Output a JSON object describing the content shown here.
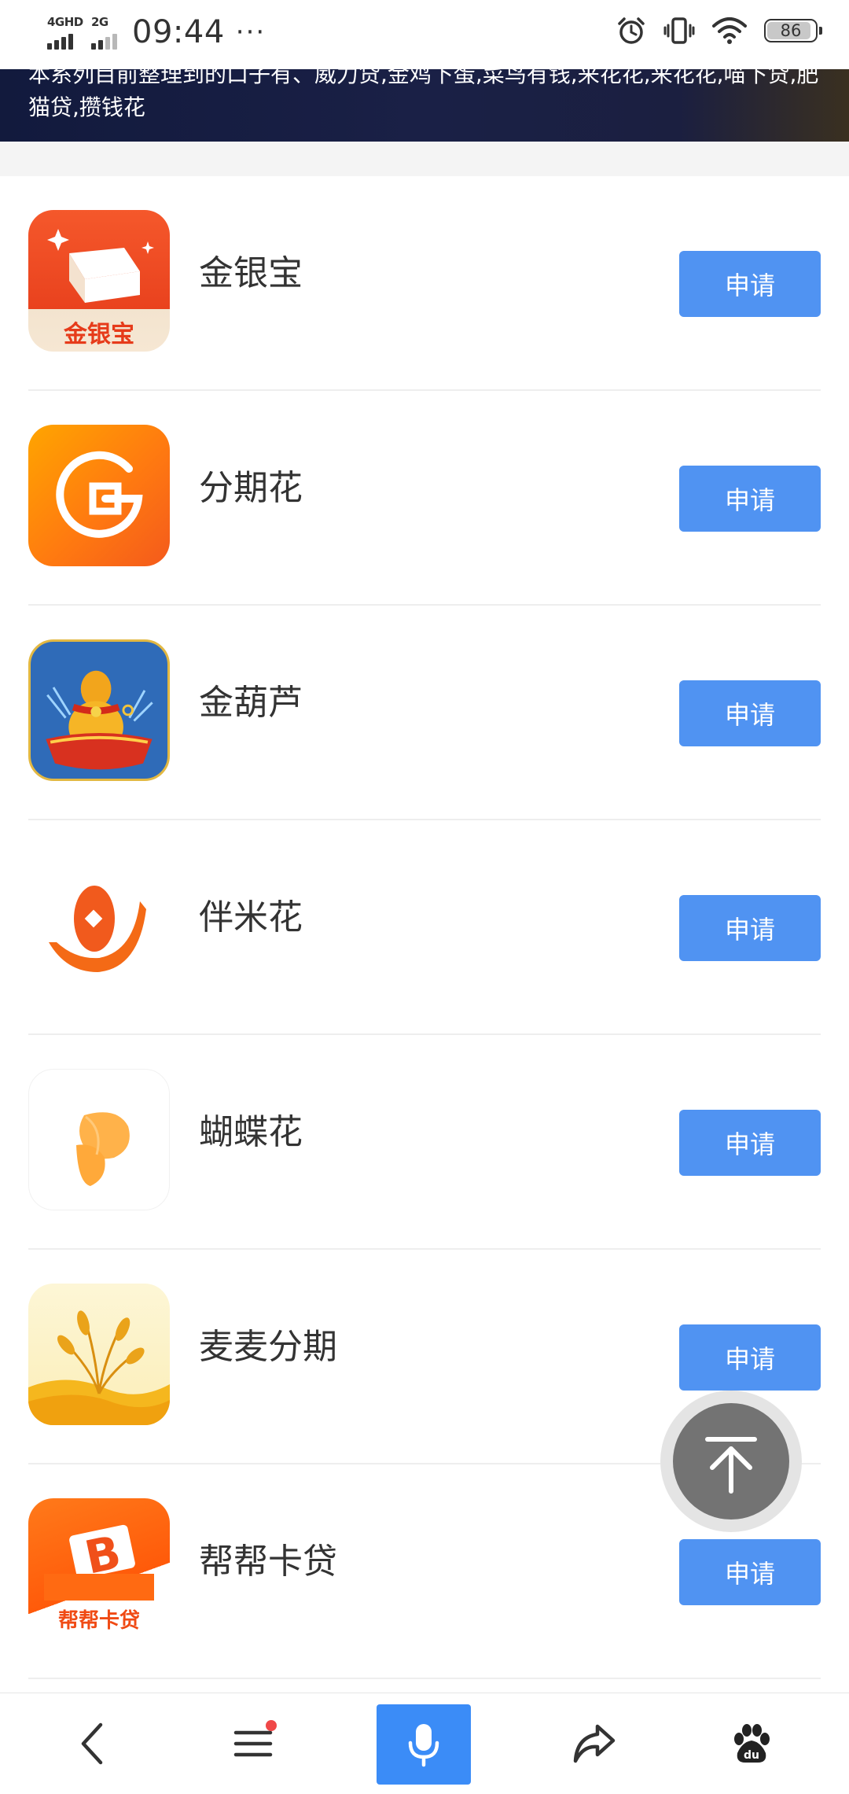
{
  "status_bar": {
    "network_1": "4GHD",
    "network_2": "2G",
    "time": "09:44",
    "more": "···",
    "battery": "86"
  },
  "banner": {
    "text": "本系列目前整理到的口子有、威力贷,金鸡下蛋,菜鸟有钱,来花花,来花花,喵下贷,肥猫贷,攒钱花"
  },
  "apply_label": "申请",
  "apps": [
    {
      "name": "金银宝",
      "icon": "gold-ingot-icon",
      "icon_text": "金银宝"
    },
    {
      "name": "分期花",
      "icon": "g-ring-icon"
    },
    {
      "name": "金葫芦",
      "icon": "gourd-icon"
    },
    {
      "name": "伴米花",
      "icon": "rice-hand-icon"
    },
    {
      "name": "蝴蝶花",
      "icon": "butterfly-icon"
    },
    {
      "name": "麦麦分期",
      "icon": "wheat-icon"
    },
    {
      "name": "帮帮卡贷",
      "icon": "b-card-icon",
      "icon_text": "帮帮卡贷"
    }
  ],
  "colors": {
    "apply_button": "#5093f2",
    "mic_button": "#3b8cf7",
    "banner_bg": "#151b3e"
  },
  "bottom_nav": {
    "items": [
      "back-icon",
      "menu-icon",
      "microphone-icon",
      "share-icon",
      "baidu-paw-icon"
    ],
    "baidu_label": "du"
  }
}
